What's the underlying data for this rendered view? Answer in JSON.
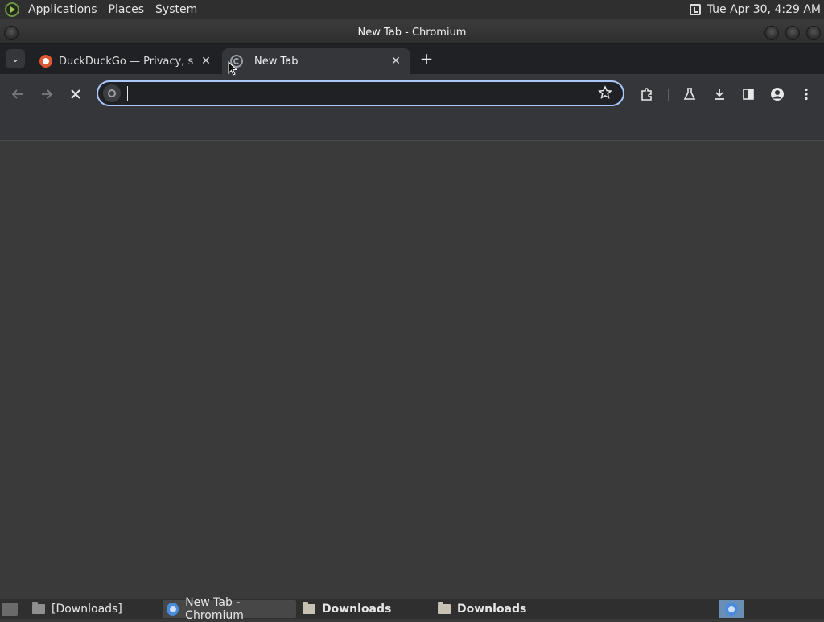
{
  "top_panel": {
    "menus": [
      "Applications",
      "Places",
      "System"
    ],
    "datetime": "Tue Apr 30,  4:29 AM"
  },
  "window": {
    "title": "New Tab - Chromium"
  },
  "tabs": [
    {
      "title": "DuckDuckGo — Privacy, simp",
      "favicon": "duckduckgo-icon",
      "active": false
    },
    {
      "title": "New Tab",
      "favicon": "loading-spinner-icon",
      "active": true
    }
  ],
  "toolbar": {
    "address_value": "",
    "icons": [
      "back-arrow-icon",
      "forward-arrow-icon",
      "stop-icon",
      "site-info-icon",
      "bookmark-star-icon",
      "extensions-icon",
      "labs-icon",
      "download-icon",
      "side-panel-icon",
      "profile-icon",
      "menu-icon"
    ]
  },
  "taskbar": {
    "items": [
      {
        "label": "[Downloads]",
        "icon": "folder-icon",
        "active": false
      },
      {
        "label": "New Tab - Chromium",
        "icon": "chromium-icon",
        "active": true
      },
      {
        "label": "Downloads",
        "icon": "folder-icon",
        "active": false
      },
      {
        "label": "Downloads",
        "icon": "folder-icon",
        "active": false
      }
    ]
  },
  "colors": {
    "panel_bg": "#2f2f2f",
    "tabstrip_bg": "#202124",
    "toolbar_bg": "#35363a",
    "omnibox_focus_border": "#a8c7fa",
    "content_bg": "#3a3a3a"
  }
}
